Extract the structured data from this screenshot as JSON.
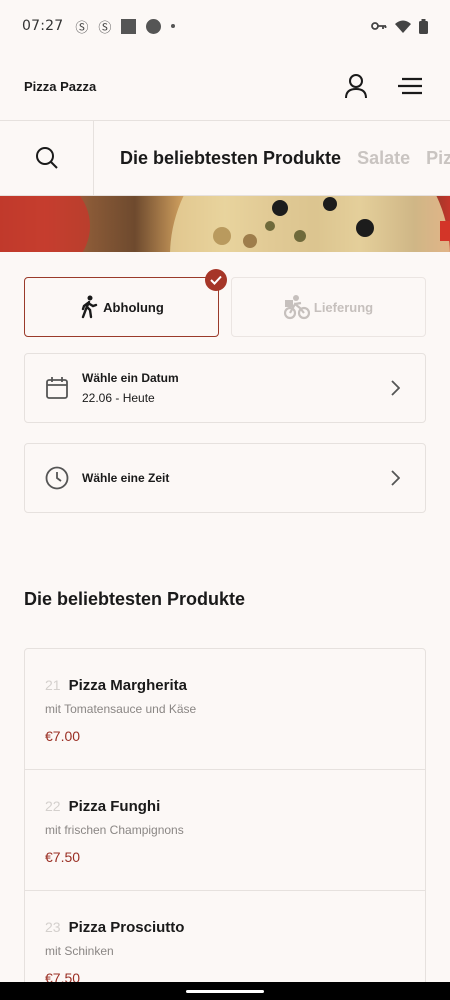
{
  "status_bar": {
    "time": "07:27"
  },
  "header": {
    "title": "Pizza Pazza"
  },
  "categories": {
    "tabs": [
      {
        "label": "Die beliebtesten Produkte",
        "active": true
      },
      {
        "label": "Salate",
        "active": false
      },
      {
        "label": "Pizza",
        "active": false
      }
    ]
  },
  "order_method": {
    "pickup_label": "Abholung",
    "delivery_label": "Lieferung",
    "selected": "pickup"
  },
  "date_picker": {
    "title": "Wähle ein Datum",
    "value": "22.06 - Heute"
  },
  "time_picker": {
    "title": "Wähle eine Zeit"
  },
  "popular": {
    "title": "Die beliebtesten Produkte",
    "products": [
      {
        "number": "21",
        "name": "Pizza Margherita",
        "desc": "mit Tomatensauce und Käse",
        "price": "€7.00"
      },
      {
        "number": "22",
        "name": "Pizza Funghi",
        "desc": "mit frischen Champignons",
        "price": "€7.50"
      },
      {
        "number": "23",
        "name": "Pizza Prosciutto",
        "desc": "mit Schinken",
        "price": "€7.50"
      }
    ]
  },
  "colors": {
    "accent": "#a63628",
    "price": "#9a2f24",
    "background": "#fcf8f6"
  }
}
